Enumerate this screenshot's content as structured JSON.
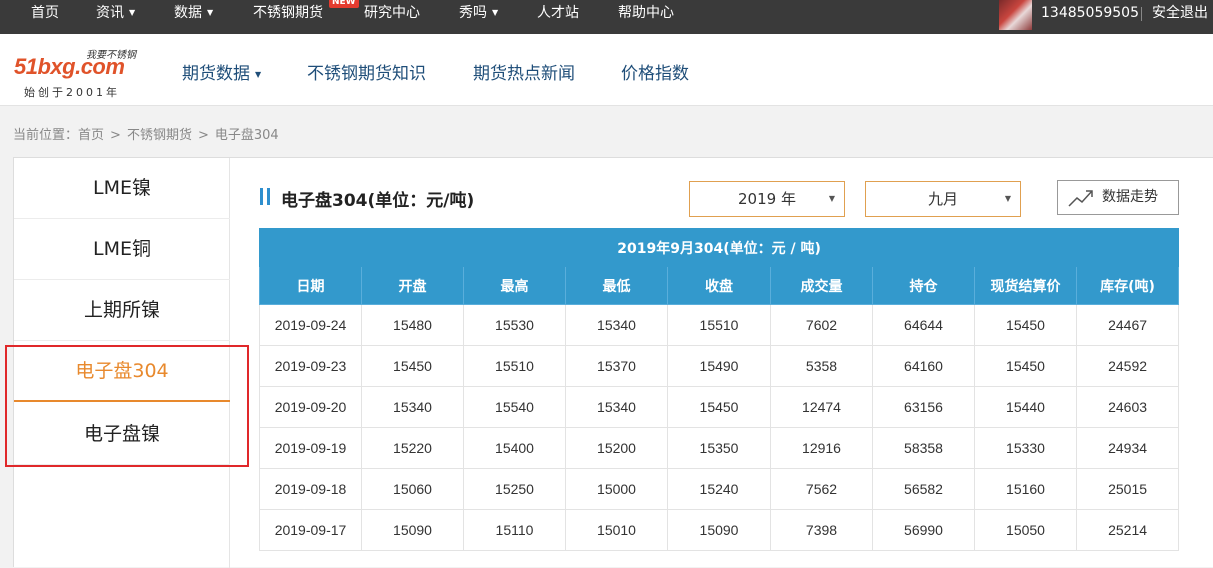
{
  "topbar": {
    "items": [
      "首页",
      "资讯",
      "数据",
      "不锈钢期货",
      "研究中心",
      "秀吗",
      "人才站",
      "帮助中心"
    ],
    "new_badge": "NEW",
    "phone": "13485059505",
    "logout": "安全退出"
  },
  "logo": {
    "slogan": "我要不锈钢",
    "wordmark": "51bxg.com",
    "since": "始创于2001年"
  },
  "mainnav": [
    "期货数据",
    "不锈钢期货知识",
    "期货热点新闻",
    "价格指数"
  ],
  "breadcrumb": {
    "label": "当前位置：",
    "items": [
      "首页",
      "不锈钢期货",
      "电子盘304"
    ],
    "separator": ">"
  },
  "sidebar": {
    "items": [
      "LME镍",
      "LME铜",
      "上期所镍",
      "电子盘304",
      "电子盘镍"
    ],
    "active": "电子盘304"
  },
  "panel": {
    "title": "电子盘304(单位：元/吨)",
    "year_select": "2019 年",
    "month_select": "九月",
    "trend_button": "数据走势"
  },
  "table": {
    "caption": "2019年9月304(单位：元 / 吨)",
    "headers": [
      "日期",
      "开盘",
      "最高",
      "最低",
      "收盘",
      "成交量",
      "持仓",
      "现货结算价",
      "库存(吨)"
    ],
    "rows": [
      [
        "2019-09-24",
        "15480",
        "15530",
        "15340",
        "15510",
        "7602",
        "64644",
        "15450",
        "24467"
      ],
      [
        "2019-09-23",
        "15450",
        "15510",
        "15370",
        "15490",
        "5358",
        "64160",
        "15450",
        "24592"
      ],
      [
        "2019-09-20",
        "15340",
        "15540",
        "15340",
        "15450",
        "12474",
        "63156",
        "15440",
        "24603"
      ],
      [
        "2019-09-19",
        "15220",
        "15400",
        "15200",
        "15350",
        "12916",
        "58358",
        "15330",
        "24934"
      ],
      [
        "2019-09-18",
        "15060",
        "15250",
        "15000",
        "15240",
        "7562",
        "56582",
        "15160",
        "25015"
      ],
      [
        "2019-09-17",
        "15090",
        "15110",
        "15010",
        "15090",
        "7398",
        "56990",
        "15050",
        "25214"
      ]
    ]
  },
  "colors": {
    "topbar_bg": "#3a3a3a",
    "nav_text": "#1f4e79",
    "table_header": "#3399cc",
    "active_orange": "#e8892d",
    "highlight_red": "#e0282a"
  }
}
